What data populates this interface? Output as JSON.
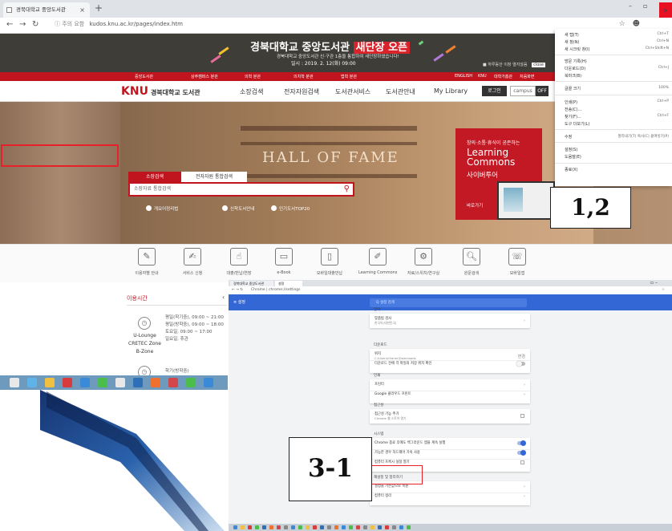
{
  "browser": {
    "tab_title": "경북대학교 중앙도서관",
    "tab_close": "×",
    "new_tab": "+",
    "url_info": "ⓘ 주의 요함",
    "url": "kudos.knu.ac.kr/pages/index.htm"
  },
  "banner": {
    "title": "경북대학교 중앙도서관",
    "title_highlight": "새단장 오픈",
    "subtitle": "경북대학교 중앙도서관 신·구관 1층을 통합하여 새단장하였습니다!",
    "date": "일시 : 2019. 2. 12(화) 09:00",
    "close_label": "■ 하루동안 이창 열지않음",
    "close_button": "close"
  },
  "redbar": {
    "items": [
      "중앙도서관",
      "상주캠퍼스 분관",
      "의학 분관",
      "의치학 분관",
      "법학 분관"
    ],
    "right": [
      "ENGLISH",
      "KNU",
      "대학가홈관",
      "처음화면"
    ]
  },
  "site_nav": {
    "logo": "KNU",
    "logo_sub": "경북대학교 도서관",
    "items": [
      "소장검색",
      "전자자원검색",
      "도서관서비스",
      "도서관안내",
      "My Library"
    ],
    "login": "로그인",
    "campus": "campus",
    "off": "OFF"
  },
  "hero": {
    "hof": "HALL OF FAME",
    "search_tabs": [
      "소장검색",
      "전자자원 통합검색"
    ],
    "search_placeholder": "소장자료 통합검색",
    "quick_links": [
      "개요어정리법",
      "신착도서안내",
      "인기도서TOP20"
    ],
    "lc_small": "창의·소통·휴식이 공존하는",
    "lc_big": [
      "Learning",
      "Commons"
    ],
    "lc_ko": "사이버투어",
    "lc_more": "바로가기"
  },
  "icon_row": [
    {
      "label": "이용자별 안내",
      "icon": "user-guide-icon",
      "glyph": "✎"
    },
    {
      "label": "서비스 신청",
      "icon": "service-request-icon",
      "glyph": "✍"
    },
    {
      "label": "대출/반납/연장",
      "icon": "loan-icon",
      "glyph": "☝"
    },
    {
      "label": "e-Book",
      "icon": "ebook-icon",
      "glyph": "▭"
    },
    {
      "label": "모바일대출반납",
      "icon": "mobile-icon",
      "glyph": "▯"
    },
    {
      "label": "Learning Commons",
      "icon": "learning-commons-icon",
      "glyph": "✐"
    },
    {
      "label": "자료/스위치/연구실",
      "icon": "settings-icon",
      "glyph": "⚙"
    },
    {
      "label": "원문검색",
      "icon": "search-doc-icon",
      "glyph": "🔍︎"
    },
    {
      "label": "모바일앱",
      "icon": "mobile-app-icon",
      "glyph": "☏"
    }
  ],
  "hours": {
    "title": "이용시간",
    "block1": [
      "평일(학기중), 09:00 ~ 21:00",
      "평일(방학중), 09:00 ~ 18:00",
      "토요일, 09:00 ~ 17:00",
      "일요일, 휴관"
    ],
    "zone": [
      "U-Lounge",
      "CRETEC Zone",
      "B-Zone"
    ],
    "block2_title": "학기(방학중)",
    "block2_line": "평일, 09:00 ~"
  },
  "menu": {
    "items": [
      {
        "label": "새 탭(T)",
        "shortcut": "Ctrl+T"
      },
      {
        "label": "새 창(N)",
        "shortcut": "Ctrl+N"
      },
      {
        "label": "새 시크릿 창(I)",
        "shortcut": "Ctrl+Shift+N"
      },
      {
        "label": "방문 기록(H)",
        "shortcut": ""
      },
      {
        "label": "다운로드(D)",
        "shortcut": "Ctrl+J"
      },
      {
        "label": "북마크(B)",
        "shortcut": ""
      },
      {
        "label": "글꼴 크기",
        "shortcut": "100%"
      },
      {
        "label": "인쇄(P)",
        "shortcut": "Ctrl+P"
      },
      {
        "label": "전송(C)...",
        "shortcut": ""
      },
      {
        "label": "찾기(F)...",
        "shortcut": "Ctrl+F"
      },
      {
        "label": "도구 더보기(L)",
        "shortcut": ""
      },
      {
        "label": "수정",
        "shortcut": "잘라내기(T)   복사(C)   붙여넣기(P)"
      },
      {
        "label": "설정(S)",
        "shortcut": ""
      },
      {
        "label": "도움말(E)",
        "shortcut": ""
      },
      {
        "label": "종료(X)",
        "shortcut": ""
      }
    ]
  },
  "callouts": {
    "step12": "1,2",
    "step31": "3-1"
  },
  "settings": {
    "tabs": [
      "경북대학교 중앙도서관",
      "설정"
    ],
    "url": "Chrome | chrome://settings",
    "header": "≡  설정",
    "search": "Q  설정 검색",
    "sections": [
      {
        "title": "언어",
        "rows": [
          {
            "label": "맞춤법 검사",
            "sub": "한국어(대한민국)",
            "control": "chevron"
          }
        ]
      },
      {
        "title": "다운로드",
        "rows": [
          {
            "label": "위치",
            "sub": "C:\\Users\\Owner\\Downloads",
            "control": "change"
          },
          {
            "label": "다운로드 전에 각 파일의 저장 위치 확인",
            "sub": "",
            "control": "toggle-off"
          }
        ]
      },
      {
        "title": "인쇄",
        "rows": [
          {
            "label": "프린터",
            "sub": "",
            "control": "chevron"
          },
          {
            "label": "Google 클라우드 프린트",
            "sub": "",
            "control": "chevron"
          }
        ]
      },
      {
        "title": "접근성",
        "rows": [
          {
            "label": "접근성 기능 추가",
            "sub": "Chrome 웹 스토어 열기",
            "control": "external"
          }
        ]
      },
      {
        "title": "시스템",
        "rows": [
          {
            "label": "Chrome 종료 후에도 백그라운드 앱을 계속 실행",
            "sub": "",
            "control": "toggle-on"
          },
          {
            "label": "가능한 경우 하드웨어 가속 사용",
            "sub": "",
            "control": "toggle-on"
          },
          {
            "label": "컴퓨터 프록시 설정 열기",
            "sub": "",
            "control": "external"
          }
        ]
      },
      {
        "title": "재설정 및 정리하기",
        "rows": [
          {
            "label": "설정을 기본값으로 복원",
            "sub": "",
            "control": "chevron"
          },
          {
            "label": "컴퓨터 정리",
            "sub": "",
            "control": "chevron"
          }
        ]
      }
    ],
    "change_label": "변경"
  },
  "colors": {
    "knu_red": "#c0151e",
    "highlight": "#e8202a",
    "settings_blue": "#3367d6"
  }
}
